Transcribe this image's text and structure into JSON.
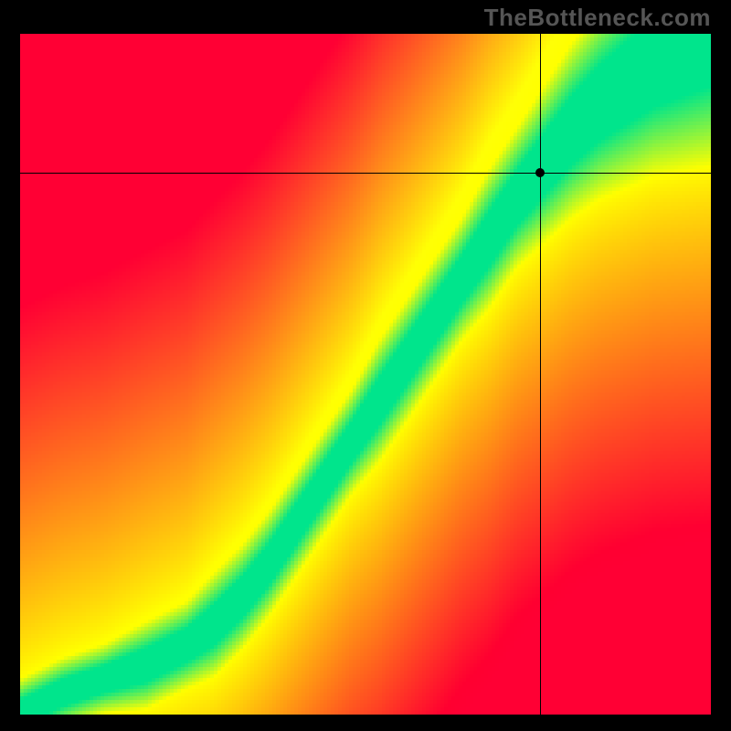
{
  "watermark": "TheBottleneck.com",
  "chart_data": {
    "type": "heatmap",
    "title": "",
    "xlabel": "",
    "ylabel": "",
    "xlim": [
      0,
      100
    ],
    "ylim": [
      0,
      100
    ],
    "colorscale": [
      "#ff0034",
      "#ffff00",
      "#00e58c"
    ],
    "ridge": [
      {
        "x": 0,
        "y": 0,
        "width": 4
      },
      {
        "x": 6,
        "y": 3,
        "width": 4
      },
      {
        "x": 12,
        "y": 5,
        "width": 4
      },
      {
        "x": 18,
        "y": 7,
        "width": 5
      },
      {
        "x": 24,
        "y": 10,
        "width": 5
      },
      {
        "x": 28,
        "y": 13,
        "width": 6
      },
      {
        "x": 32,
        "y": 17,
        "width": 6
      },
      {
        "x": 36,
        "y": 22,
        "width": 6
      },
      {
        "x": 40,
        "y": 28,
        "width": 6
      },
      {
        "x": 44,
        "y": 34,
        "width": 6
      },
      {
        "x": 48,
        "y": 40,
        "width": 6
      },
      {
        "x": 52,
        "y": 46,
        "width": 7
      },
      {
        "x": 56,
        "y": 52,
        "width": 7
      },
      {
        "x": 60,
        "y": 58,
        "width": 7
      },
      {
        "x": 64,
        "y": 64,
        "width": 7
      },
      {
        "x": 68,
        "y": 70,
        "width": 8
      },
      {
        "x": 72,
        "y": 76,
        "width": 8
      },
      {
        "x": 76,
        "y": 81,
        "width": 9
      },
      {
        "x": 80,
        "y": 86,
        "width": 10
      },
      {
        "x": 84,
        "y": 90,
        "width": 11
      },
      {
        "x": 88,
        "y": 93,
        "width": 12
      },
      {
        "x": 92,
        "y": 96,
        "width": 13
      },
      {
        "x": 96,
        "y": 98,
        "width": 14
      },
      {
        "x": 100,
        "y": 100,
        "width": 15
      }
    ],
    "crosshair": {
      "x": 75.3,
      "y": 79.6
    },
    "description": "Heatmap field where a curved green ridge marks the optimal balance; color distance from ridge transitions through yellow to red. A black crosshair marks a queried point near the ridge in the upper-right region."
  }
}
